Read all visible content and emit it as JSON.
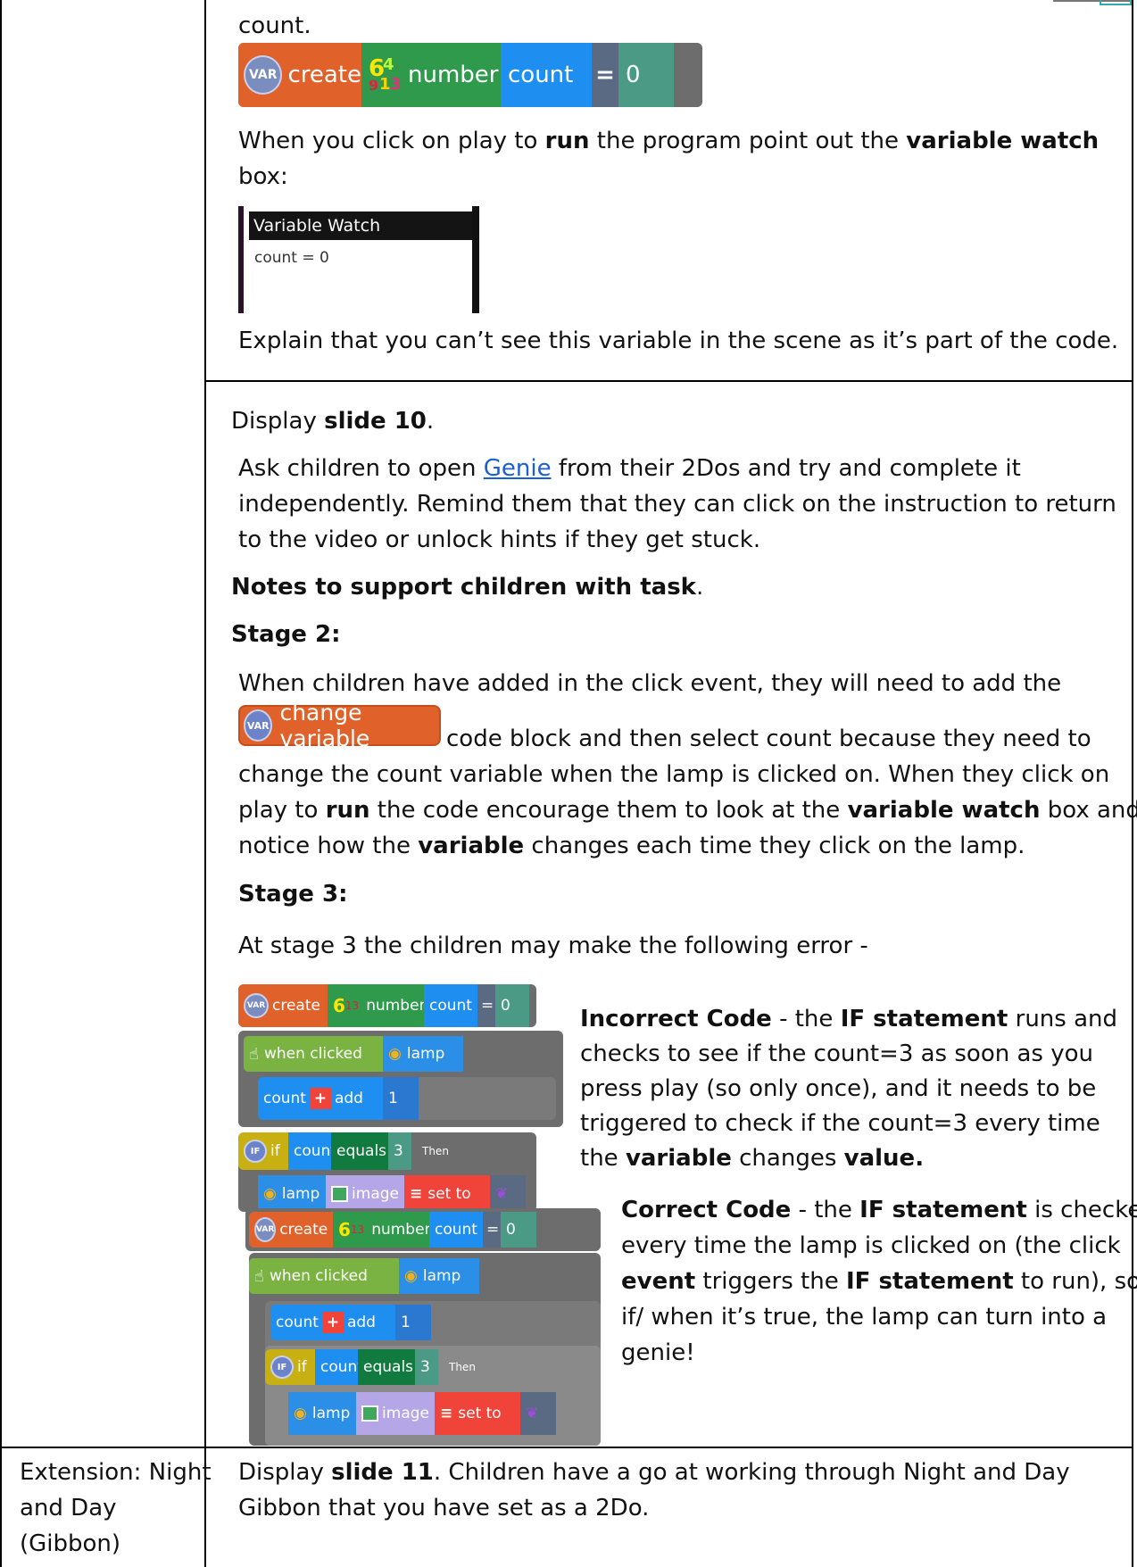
{
  "row1": {
    "intro_text": "count.",
    "create_block": {
      "var_badge": "VAR",
      "create_label": "create",
      "number_glyph": [
        "6",
        "4",
        "9",
        "1",
        "3"
      ],
      "type_label": "number",
      "name_label": "count",
      "equals": "=",
      "value": "0"
    },
    "paragraph1": {
      "line1_prefix": "When you click on play to ",
      "line1_bold1": "run",
      "line1_middle": " the program point out the ",
      "line1_bold2": "variable watch",
      "line2": "box:"
    },
    "variable_watch": {
      "title": "Variable Watch",
      "row": "count = 0"
    },
    "explain_text": "Explain that you can’t see this variable in the scene as it’s part of the code."
  },
  "row2": {
    "display_prefix": "Display ",
    "display_bold": "slide 10",
    "display_suffix": ".",
    "ask_line1_prefix": "Ask children to open ",
    "ask_link": "Genie",
    "ask_line1_suffix": " from their 2Dos and try and complete it",
    "ask_line2": "independently. Remind them that they can click on the instruction to return",
    "ask_line3": "to the video or unlock hints if they get stuck.",
    "notes_heading": "Notes to support children with task",
    "notes_dot": ".",
    "stage2_heading": "Stage 2:",
    "stage2_line1": "When children have added in the click event, they will need to add the",
    "change_variable_label": "change variable",
    "stage2_line2": "code block and then select count because they need to",
    "stage2_line3": "change the count variable when the lamp is clicked on. When they click on",
    "stage2_line4_prefix": "play to ",
    "stage2_line4_bold1": "run",
    "stage2_line4_middle": " the code encourage them to look at the ",
    "stage2_line4_bold2": "variable watch",
    "stage2_line4_suffix": " box and",
    "stage2_line5_prefix": "notice how the ",
    "stage2_line5_bold": "variable",
    "stage2_line5_suffix": " changes each time they click on the lamp.",
    "stage3_heading": "Stage 3:",
    "stage3_line1": "At stage 3 the children may make the following error -",
    "code_labels": {
      "var": "VAR",
      "create": "create",
      "number": "number",
      "count": "count",
      "equals": "=",
      "zero": "0",
      "when_clicked": "when clicked",
      "lamp": "lamp",
      "add": "add",
      "one": "1",
      "if_badge": "IF",
      "if": "if",
      "equals_word": "equals",
      "three": "3",
      "then": "Then",
      "image": "image",
      "set_to": "set to"
    },
    "incorrect": {
      "bold1": "Incorrect Code",
      "l1_mid": " - the ",
      "bold2": "IF statement",
      "l1_end": " runs and",
      "l2": "checks to see if the count=3 as soon as you",
      "l3": "press play (so only once), and it needs to be",
      "l4": "triggered to check if the count=3 every time",
      "l5_prefix": "the ",
      "l5_bold1": "variable",
      "l5_mid": " changes ",
      "l5_bold2": "value."
    },
    "correct": {
      "bold1": "Correct Code",
      "l1_mid": " - the ",
      "bold2": "IF statement",
      "l1_end": " is checked",
      "l2": "every time the lamp is clicked on (the click",
      "l3_bold": "event",
      "l3_mid": " triggers the ",
      "l3_bold2": "IF statement",
      "l3_end": " to run), so",
      "l4": "if/ when it’s true, the lamp can turn into a",
      "l5": "genie!"
    }
  },
  "row3": {
    "left_line1": "Extension: Night",
    "left_line2": "and Day",
    "left_line3": "(Gibbon)",
    "right_prefix": "Display ",
    "right_bold": "slide 11",
    "right_line1_suffix": ". Children have a go at working through Night and Day",
    "right_line2": "Gibbon that you have set as a 2Do."
  },
  "colors": {
    "create_orange": "#e0622a",
    "number_green": "#2f9a4c",
    "count_blue": "#1e8ef0",
    "value_teal": "#4a9a86",
    "event_green": "#7ab342",
    "lamp_blue": "#2b8fe8",
    "if_yellow": "#c9b012",
    "equals_green": "#117a3e",
    "image_purple": "#b5a6e8",
    "set_red": "#f0443a",
    "block_gray": "#6d6d6d"
  }
}
